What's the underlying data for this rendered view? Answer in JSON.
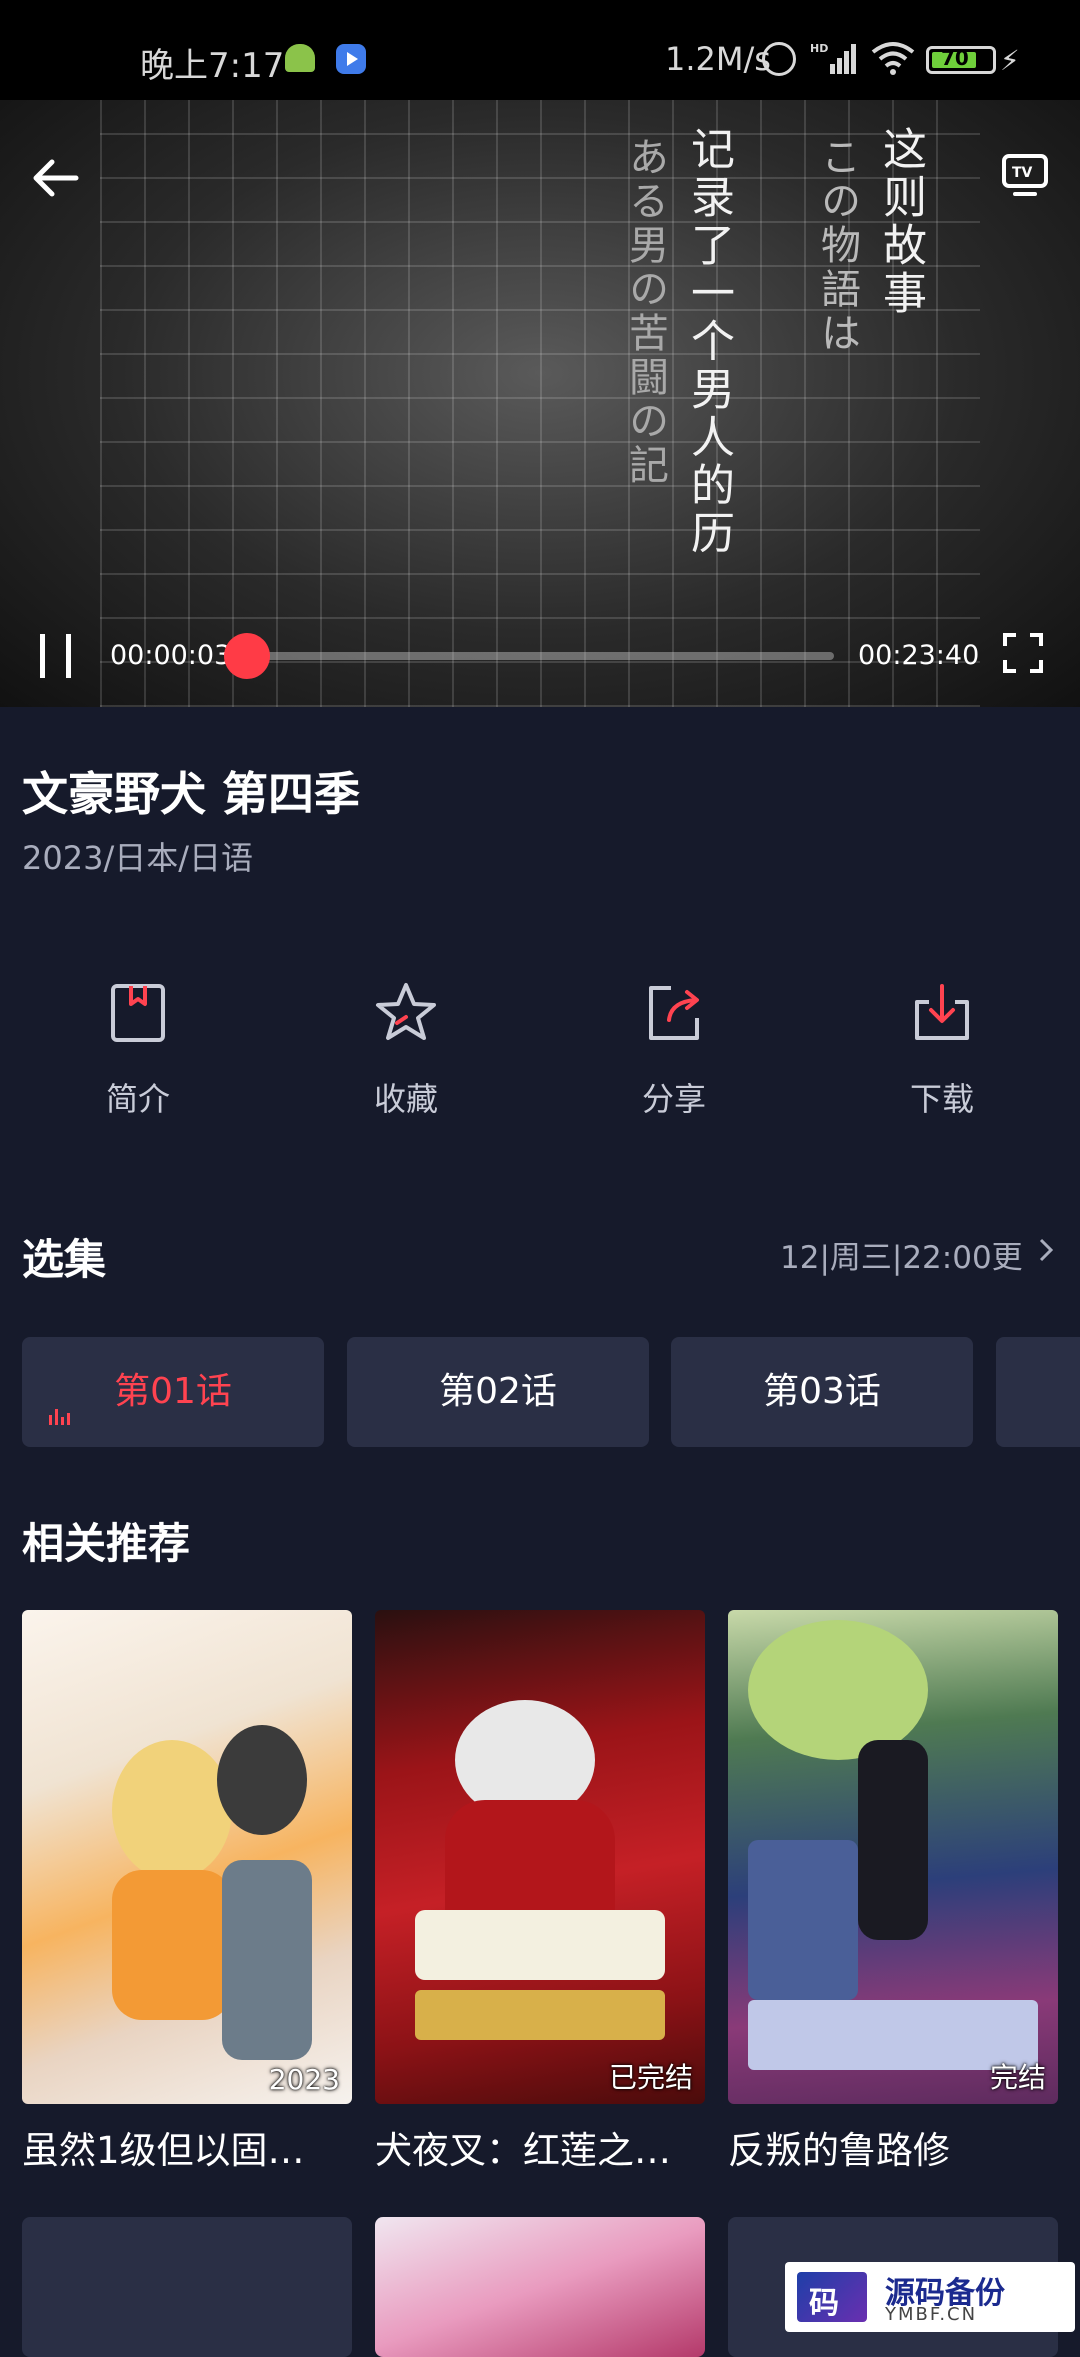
{
  "status_bar": {
    "time": "晚上7:17",
    "speed": "1.2M/s",
    "battery": "70",
    "icons": [
      "android-icon",
      "play-app-icon",
      "alarm-icon",
      "hd-signal-icon",
      "wifi-icon",
      "battery-icon",
      "charging-icon"
    ]
  },
  "player": {
    "overlay_text": {
      "col1": "这则故事",
      "col2": "この物語は",
      "col3": "记录了一个男人的历",
      "col4": "ある男の苦闘の記"
    },
    "current_time": "00:00:03",
    "total_time": "00:23:40",
    "progress": 0.002,
    "accent": "#ff3b46"
  },
  "show": {
    "title": "文豪野犬 第四季",
    "meta": "2023/日本/日语"
  },
  "actions": [
    {
      "label": "简介",
      "icon": "bookmark-icon"
    },
    {
      "label": "收藏",
      "icon": "star-icon"
    },
    {
      "label": "分享",
      "icon": "share-icon"
    },
    {
      "label": "下载",
      "icon": "download-icon"
    }
  ],
  "episodes": {
    "heading": "选集",
    "schedule": "12|周三|22:00更",
    "items": [
      {
        "label": "第01话",
        "active": true
      },
      {
        "label": "第02话",
        "active": false
      },
      {
        "label": "第03话",
        "active": false
      }
    ]
  },
  "recommend": {
    "heading": "相关推荐",
    "items": [
      {
        "title": "虽然1级但以固…",
        "badge": "2023"
      },
      {
        "title": "犬夜叉：红莲之…",
        "badge": "已完结"
      },
      {
        "title": "反叛的鲁路修",
        "badge": "完结"
      }
    ]
  },
  "watermark": {
    "mark": "码",
    "name": "源码备份",
    "domain": "YMBF.CN"
  }
}
